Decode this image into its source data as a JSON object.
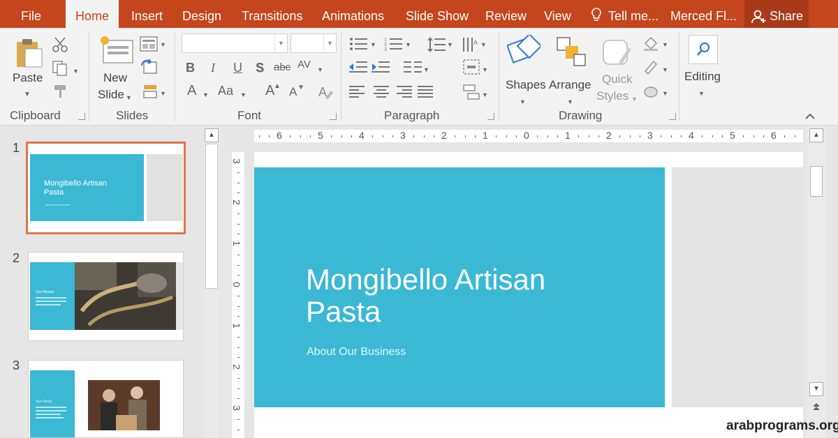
{
  "tabs": [
    {
      "label": "File"
    },
    {
      "label": "Home",
      "active": true
    },
    {
      "label": "Insert"
    },
    {
      "label": "Design"
    },
    {
      "label": "Transitions"
    },
    {
      "label": "Animations"
    },
    {
      "label": "Slide Show"
    },
    {
      "label": "Review"
    },
    {
      "label": "View"
    }
  ],
  "tell_me": "Tell me...",
  "user_name": "Merced Fl...",
  "share_label": "Share",
  "ribbon": {
    "clipboard": {
      "group_label": "Clipboard",
      "paste_label": "Paste"
    },
    "slides": {
      "group_label": "Slides",
      "new_slide_label_1": "New",
      "new_slide_label_2": "Slide"
    },
    "font": {
      "group_label": "Font",
      "font_name": "",
      "font_size": "",
      "bold": "B",
      "italic": "I",
      "underline": "U",
      "shadow": "S",
      "strikethrough": "abc",
      "spacing": "AV",
      "grow": "A",
      "shrink": "A",
      "case": "Aa",
      "color": "A"
    },
    "paragraph": {
      "group_label": "Paragraph"
    },
    "drawing": {
      "group_label": "Drawing",
      "shapes_label": "Shapes",
      "arrange_label": "Arrange",
      "quick_styles_1": "Quick",
      "quick_styles_2": "Styles"
    },
    "editing": {
      "label": "Editing"
    }
  },
  "slides": [
    {
      "number": "1",
      "title": "Mongibello Artisan Pasta",
      "subtitle": "About Our Business",
      "selected": true
    },
    {
      "number": "2",
      "title": "Our Mission"
    },
    {
      "number": "3",
      "title": "Our Focus"
    }
  ],
  "ruler": {
    "horizontal": [
      "6",
      "5",
      "4",
      "3",
      "2",
      "1",
      "0",
      "1",
      "2",
      "3",
      "4",
      "5",
      "6"
    ],
    "vertical": [
      "3",
      "2",
      "1",
      "0",
      "1",
      "2",
      "3"
    ]
  },
  "main_slide": {
    "title_line1": "Mongibello Artisan",
    "title_line2": "Pasta",
    "subtitle": "About Our Business",
    "accent_color": "#3ab8d4"
  },
  "colors": {
    "tab_bar": "#c5451d",
    "ribbon": "#f3f3f3",
    "selection_border": "#e2734d"
  },
  "watermark": "arabprograms.org"
}
